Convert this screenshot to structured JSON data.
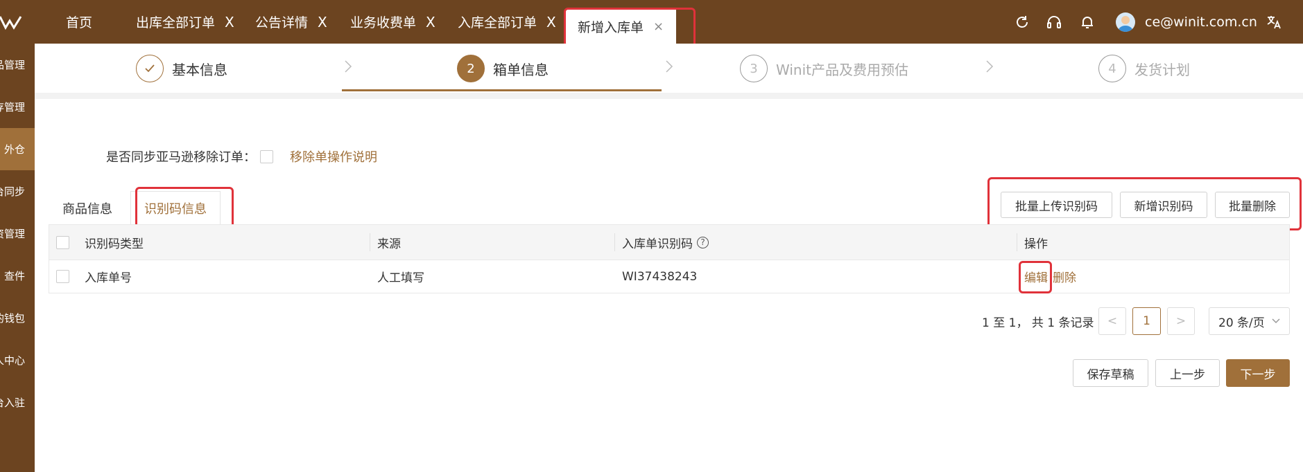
{
  "header": {
    "tabs": [
      {
        "label": "首页",
        "closable": false
      },
      {
        "label": "出库全部订单",
        "closable": true
      },
      {
        "label": "公告详情",
        "closable": true
      },
      {
        "label": "业务收费单",
        "closable": true
      },
      {
        "label": "入库全部订单",
        "closable": true
      },
      {
        "label": "新增入库单",
        "closable": true,
        "active": true
      }
    ],
    "close_glyph": "X",
    "active_close_glyph": "×",
    "user_email": "ce@winit.com.cn",
    "icons": [
      "refresh-icon",
      "headset-icon",
      "bell-icon",
      "avatar",
      "translate-icon"
    ]
  },
  "sidebar": {
    "items": [
      {
        "label": "品管理"
      },
      {
        "label": "存管理"
      },
      {
        "label": "外仓",
        "active": true
      },
      {
        "label": "台同步"
      },
      {
        "label": "资管理"
      },
      {
        "label": "查件"
      },
      {
        "label": "的钱包"
      },
      {
        "label": "人中心"
      },
      {
        "label": "台入驻"
      }
    ]
  },
  "steps": [
    {
      "num": "",
      "label": "基本信息",
      "state": "done"
    },
    {
      "num": "2",
      "label": "箱单信息",
      "state": "current"
    },
    {
      "num": "3",
      "label": "Winit产品及费用预估",
      "state": "pending"
    },
    {
      "num": "4",
      "label": "发货计划",
      "state": "pending"
    }
  ],
  "sync": {
    "label": "是否同步亚马逊移除订单：",
    "checked": false,
    "help_link": "移除单操作说明"
  },
  "subtabs": [
    {
      "label": "商品信息",
      "active": false
    },
    {
      "label": "识别码信息",
      "active": true
    }
  ],
  "actions": {
    "batch_upload": "批量上传识别码",
    "add": "新增识别码",
    "batch_delete": "批量删除"
  },
  "table": {
    "columns": [
      "识别码类型",
      "来源",
      "入库单识别码",
      "操作"
    ],
    "help_glyph": "?",
    "rows": [
      {
        "type": "入库单号",
        "source": "人工填写",
        "code": "WI37438243",
        "edit": "编辑",
        "delete": "删除"
      }
    ]
  },
  "pagination": {
    "summary": "1 至 1，  共 1 条记录",
    "prev": "<",
    "current_page": "1",
    "next": ">",
    "page_size": "20 条/页"
  },
  "footer": {
    "save_draft": "保存草稿",
    "prev_step": "上一步",
    "next_step": "下一步"
  },
  "colors": {
    "brand_dark": "#6c4420",
    "accent": "#a0703a",
    "highlight": "#e0323a"
  }
}
